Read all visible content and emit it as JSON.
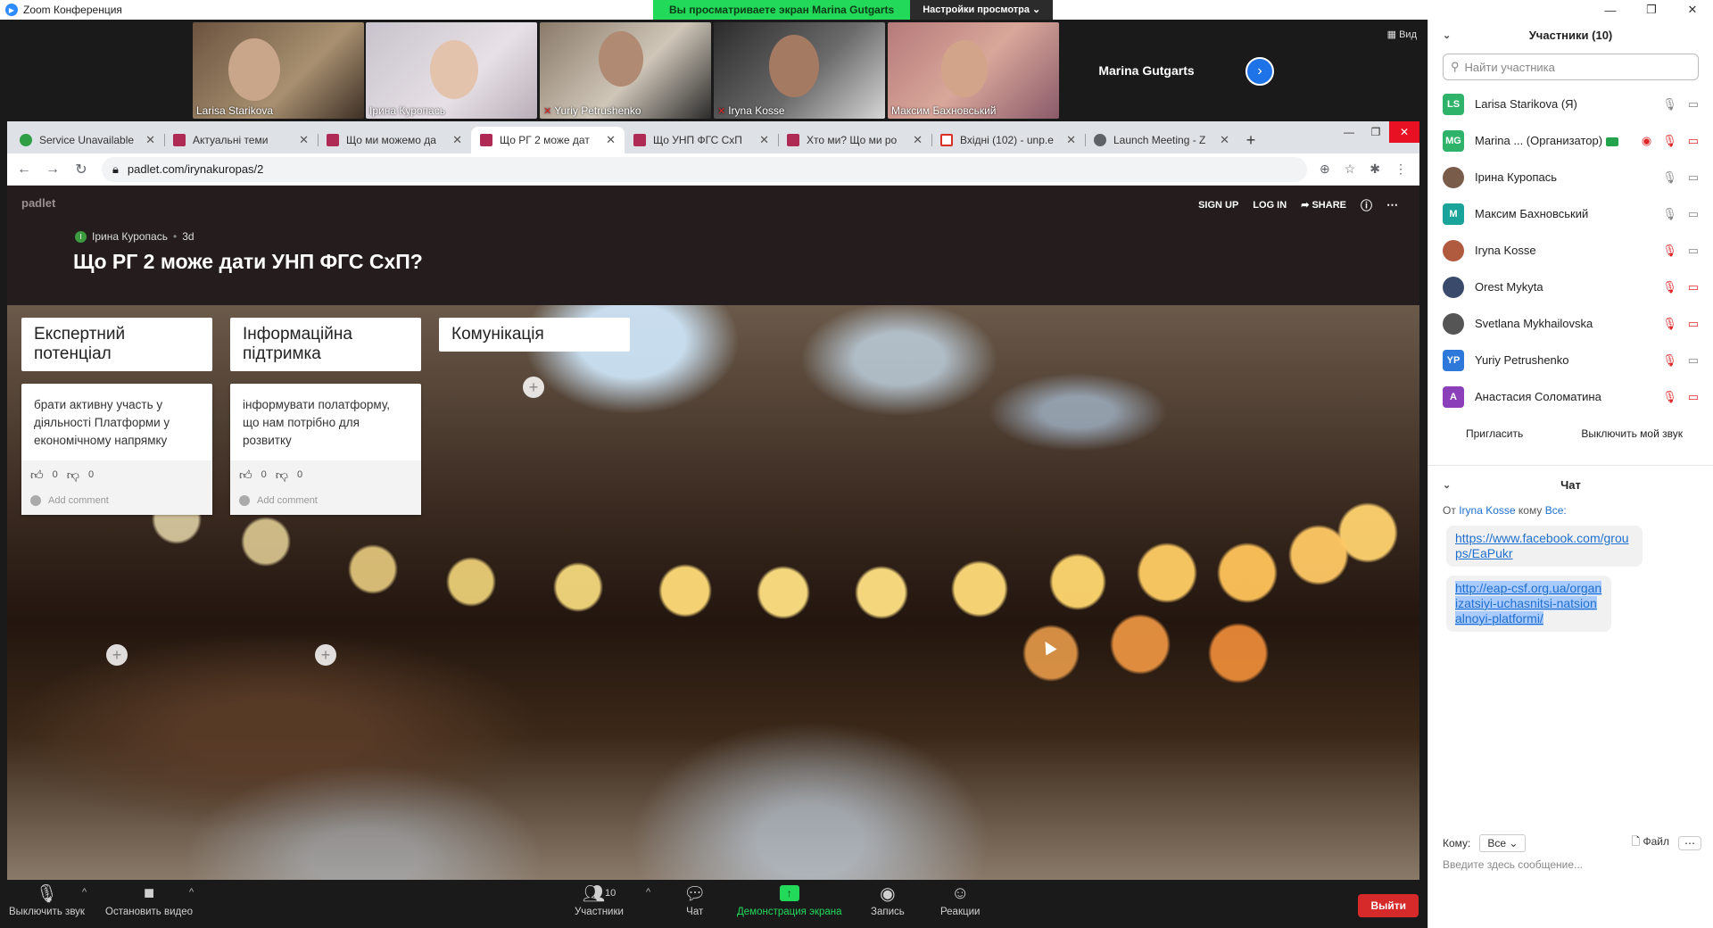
{
  "zoom": {
    "window_title": "Zoom Конференция",
    "viewing_banner": "Вы просматриваете экран Marina Gutgarts",
    "view_options": "Настройки просмотра ⌄",
    "view_label": "Вид",
    "active_speaker": "Marina Gutgarts",
    "video_tiles": [
      {
        "name": "Larisa Starikova",
        "muted": false
      },
      {
        "name": "Ірина Куропась",
        "muted": false
      },
      {
        "name": "Yuriy Petrushenko",
        "muted": true
      },
      {
        "name": "Iryna Kosse",
        "muted": true
      },
      {
        "name": "Максим Бахновський",
        "muted": false
      }
    ],
    "toolbar": {
      "mute": "Выключить звук",
      "stop_video": "Остановить видео",
      "participants": "Участники",
      "participants_count": "10",
      "chat": "Чат",
      "share": "Демонстрация экрана",
      "record": "Запись",
      "reactions": "Реакции",
      "end": "Выйти"
    }
  },
  "browser": {
    "tabs": [
      {
        "label": "Service Unavailable",
        "icon": "shield-icon",
        "color": "#2f9e44"
      },
      {
        "label": "Актуальні теми",
        "icon": "padlet-icon",
        "color": "#b02a56"
      },
      {
        "label": "Що ми можемо да",
        "icon": "padlet-icon",
        "color": "#b02a56"
      },
      {
        "label": "Що РГ 2 може дат",
        "icon": "padlet-icon",
        "color": "#b02a56",
        "active": true
      },
      {
        "label": "Що УНП ФГС СхП",
        "icon": "padlet-icon",
        "color": "#b02a56"
      },
      {
        "label": "Хто ми? Що ми ро",
        "icon": "padlet-icon",
        "color": "#b02a56"
      },
      {
        "label": "Вхідні (102) - unp.e",
        "icon": "gmail-icon",
        "color": "#d93025"
      },
      {
        "label": "Launch Meeting - Z",
        "icon": "globe-icon",
        "color": "#5f6368"
      }
    ],
    "url": "padlet.com/irynakuropas/2"
  },
  "padlet": {
    "logo": "padlet",
    "actions": {
      "signup": "SIGN UP",
      "login": "LOG IN",
      "share": "SHARE"
    },
    "author": "Ірина Куропась",
    "author_initial": "І",
    "age": "3d",
    "title": "Що РГ 2 може дати УНП ФГС СхП?",
    "columns": [
      {
        "title": "Експертний потенціал",
        "post": "брати активну участь у діяльності Платформи у економічному напрямку",
        "likes": "0",
        "dislikes": "0",
        "comment": "Add comment"
      },
      {
        "title": "Інформаційна підтримка",
        "post": "інформувати полатформу, що нам потрібно для розвитку",
        "likes": "0",
        "dislikes": "0",
        "comment": "Add comment"
      },
      {
        "title": "Комунікація"
      }
    ]
  },
  "participants_panel": {
    "title": "Участники (10)",
    "search_placeholder": "Найти участника",
    "invite": "Пригласить",
    "mute_all": "Выключить мой звук",
    "items": [
      {
        "initials": "LS",
        "name": "Larisa Starikova (Я)",
        "color": "#2fb36a",
        "mic": "on",
        "video": "on"
      },
      {
        "initials": "MG",
        "name": "Marina ... (Организатор)",
        "color": "#2fb36a",
        "mic": "off",
        "video": "off",
        "host": true
      },
      {
        "initials": "",
        "name": "Ірина Куропась",
        "color": "#7a5c4a",
        "mic": "on",
        "video": "on"
      },
      {
        "initials": "M",
        "name": "Максим Бахновський",
        "color": "#1aa39a",
        "mic": "on",
        "video": "on"
      },
      {
        "initials": "",
        "name": "Iryna Kosse",
        "color": "#b05a40",
        "mic": "off",
        "video": "on"
      },
      {
        "initials": "",
        "name": "Orest Mykyta",
        "color": "#3a4a6a",
        "mic": "off",
        "video": "off"
      },
      {
        "initials": "",
        "name": "Svetlana Mykhailovska",
        "color": "#555555",
        "mic": "off",
        "video": "off"
      },
      {
        "initials": "YP",
        "name": "Yuriy Petrushenko",
        "color": "#2d78d8",
        "mic": "off",
        "video": "on"
      },
      {
        "initials": "A",
        "name": "Анастасия Соломатина",
        "color": "#8b3fb8",
        "mic": "off",
        "video": "off"
      }
    ]
  },
  "chat": {
    "title": "Чат",
    "from_prefix": "От",
    "from": "Iryna Kosse",
    "to_prefix": "кому",
    "to": "Все:",
    "messages": [
      "https://www.facebook.com/groups/EaPukr",
      "http://eap-csf.org.ua/organizatsiyi-uchasnitsi-natsionalnoyi-platformi/"
    ],
    "to_label": "Кому:",
    "to_value": "Все",
    "file_label": "Файл",
    "input_placeholder": "Введите здесь сообщение..."
  }
}
